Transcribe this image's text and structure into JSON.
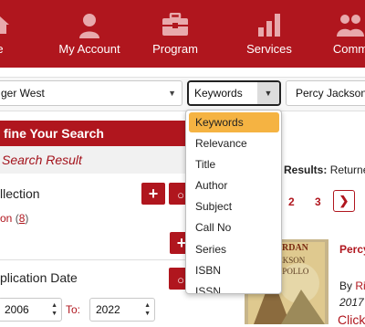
{
  "nav": {
    "items": [
      {
        "label": "e",
        "icon": "home-icon"
      },
      {
        "label": "My Account",
        "icon": "user-icon"
      },
      {
        "label": "Program",
        "icon": "briefcase-icon"
      },
      {
        "label": "Services",
        "icon": "bar-chart-icon"
      },
      {
        "label": "Comm",
        "icon": "community-icon"
      }
    ]
  },
  "search": {
    "text_value": "ger West",
    "field_value": "Keywords",
    "series_value": "Percy Jackson"
  },
  "dropdown": {
    "options": [
      "Keywords",
      "Relevance",
      "Title",
      "Author",
      "Subject",
      "Call No",
      "Series",
      "ISBN",
      "ISSN"
    ],
    "selected": "Keywords"
  },
  "refine": {
    "header": "fine Your Search",
    "search_result": "Search Result",
    "collection_title": "llection",
    "collection_facet": "on",
    "collection_count": "8",
    "pubdate_title": "plication Date",
    "year_from": "2006",
    "to_label": "To:",
    "year_to": "2022"
  },
  "results": {
    "label": "Results:",
    "label_rest": "Returne",
    "pages": [
      "2",
      "3"
    ]
  },
  "book": {
    "title": "Percy",
    "by_prefix": "By",
    "author": "Ri",
    "year": "2017",
    "click": "Click",
    "cover_top": "RIORDAN",
    "cover_mid": "JACKSON",
    "cover_bottom": "R • APOLLO"
  },
  "colors": {
    "brand": "#b0161e",
    "highlight": "#f5b342"
  }
}
